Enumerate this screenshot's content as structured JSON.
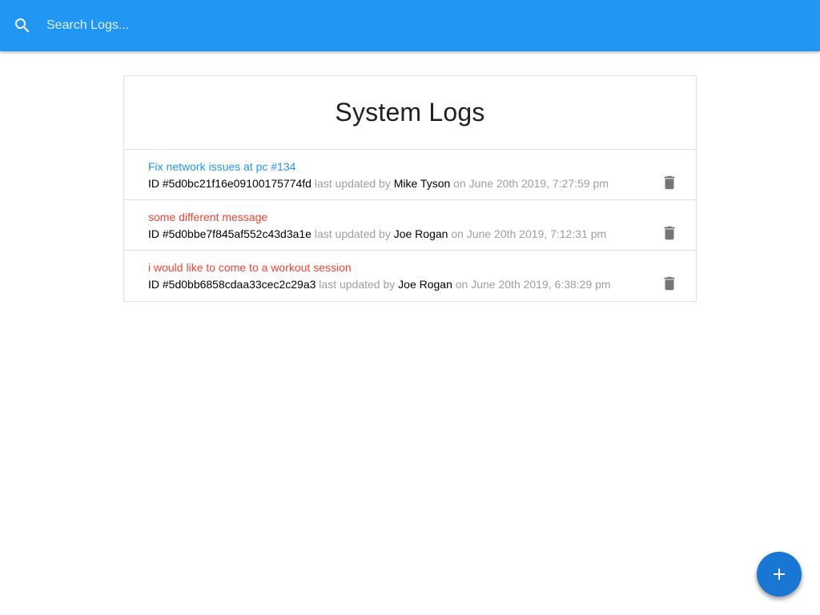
{
  "search": {
    "placeholder": "Search Logs...",
    "value": ""
  },
  "page": {
    "title": "System Logs"
  },
  "logs": [
    {
      "message": "Fix network issues at pc #134",
      "id_text": "ID #5d0bc21f16e09100175774fd",
      "updated_label": "last updated by",
      "tech": "Mike Tyson",
      "date_text": "on June 20th 2019, 7:27:59 pm",
      "attention": false
    },
    {
      "message": "some different message",
      "id_text": "ID #5d0bbe7f845af552c43d3a1e",
      "updated_label": "last updated by",
      "tech": "Joe Rogan",
      "date_text": "on June 20th 2019, 7:12:31 pm",
      "attention": true
    },
    {
      "message": "i would like to come to a workout session",
      "id_text": "ID #5d0bb6858cdaa33cec2c29a3",
      "updated_label": "last updated by",
      "tech": "Joe Rogan",
      "date_text": "on June 20th 2019, 6:38:29 pm",
      "attention": true
    }
  ],
  "icons": {
    "search": "search-icon",
    "delete": "delete-icon",
    "add": "add-icon"
  },
  "colors": {
    "header": "#2196f3",
    "normal_message": "#2196f3",
    "attention_message": "#f44336",
    "fab": "#1976d2",
    "delete_icon": "#757575"
  }
}
